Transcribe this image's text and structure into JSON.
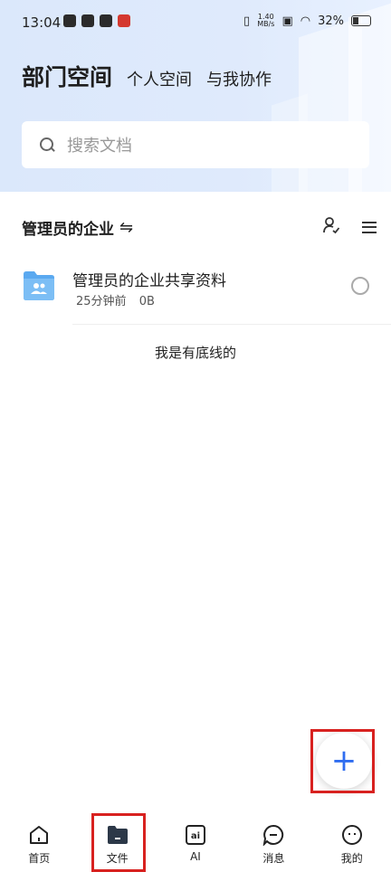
{
  "status_bar": {
    "time": "13:04",
    "net_speed_value": "1.40",
    "net_speed_unit": "MB/s",
    "battery": "32%"
  },
  "header": {
    "tabs": [
      {
        "label": "部门空间",
        "active": true
      },
      {
        "label": "个人空间",
        "active": false
      },
      {
        "label": "与我协作",
        "active": false
      }
    ],
    "search_placeholder": "搜索文档"
  },
  "section": {
    "title": "管理员的企业",
    "swap_icon": "⇋"
  },
  "files": [
    {
      "name": "管理员的企业共享资料",
      "time": "25分钟前",
      "size": "0B"
    }
  ],
  "footer_text": "我是有底线的",
  "fab": {
    "icon": "+"
  },
  "bottom_nav": [
    {
      "label": "首页",
      "icon": "home-icon"
    },
    {
      "label": "文件",
      "icon": "folder-icon",
      "active": true
    },
    {
      "label": "AI",
      "icon": "ai-icon"
    },
    {
      "label": "消息",
      "icon": "message-icon"
    },
    {
      "label": "我的",
      "icon": "profile-icon"
    }
  ],
  "colors": {
    "accent": "#2f6df0",
    "highlight_box": "#d8211f",
    "header_bg": "#dbe8fb"
  }
}
